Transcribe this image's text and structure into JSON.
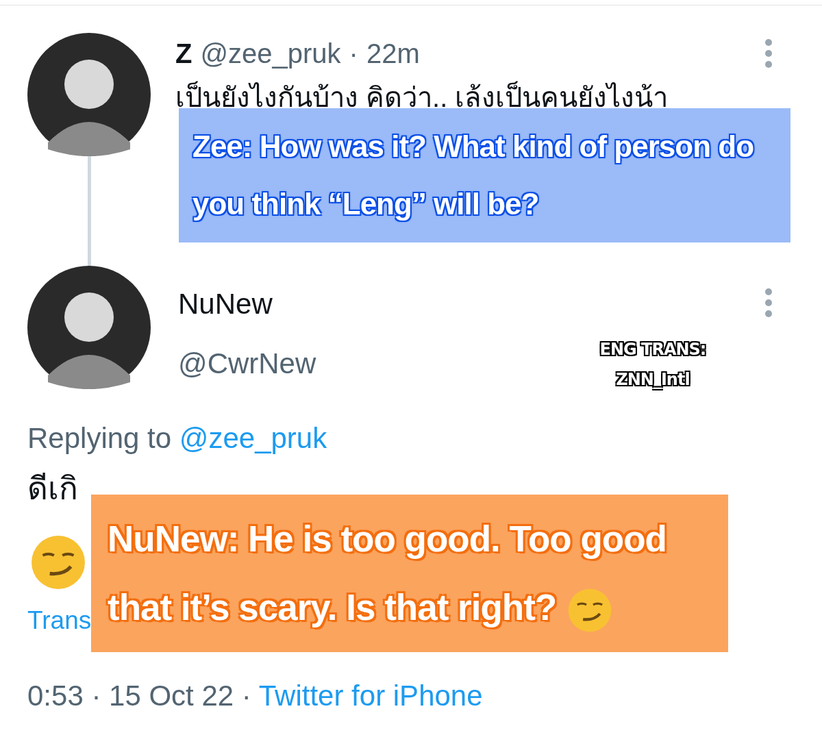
{
  "tweets": [
    {
      "name": "Z",
      "handle": "@zee_pruk",
      "dot": "·",
      "time": "22m",
      "text": "เป็นยังไงกันบ้าง คิดว่า.. เล้งเป็นคนยังไงน้า"
    },
    {
      "name": "NuNew",
      "handle": "@CwrNew",
      "replying_label": "Replying to",
      "replying_handle": "@zee_pruk",
      "text_start": "ดีเกิ",
      "translate": "Trans",
      "timestamp": "0:53 · 15 Oct 22 · ",
      "source": "Twitter for iPhone"
    }
  ],
  "overlays": [
    {
      "kind": "blue",
      "text": "Zee: How was it? What kind of person do you think “Leng” will be?"
    },
    {
      "kind": "orange",
      "text": "NuNew: He is too good. Too good that it’s scary. Is that right?"
    }
  ],
  "credit": {
    "line1": "ENG TRANS:",
    "line2": "ZNN_Intl"
  }
}
